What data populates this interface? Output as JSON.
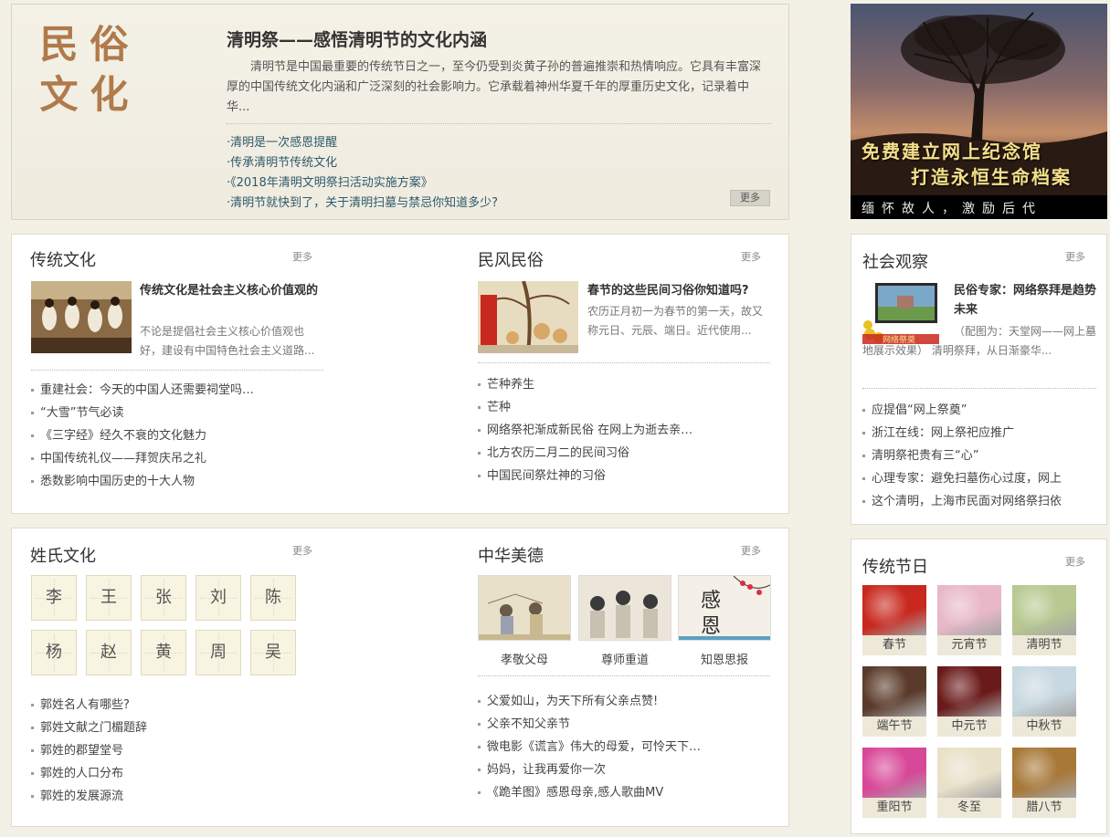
{
  "feature": {
    "logo_chars": [
      "民",
      "俗",
      "文",
      "化"
    ],
    "title": "清明祭——感悟清明节的文化内涵",
    "description": "清明节是中国最重要的传统节日之一，至今仍受到炎黄子孙的普遍推崇和热情响应。它具有丰富深厚的中国传统文化内涵和广泛深刻的社会影响力。它承载着神州华夏千年的厚重历史文化，记录着中华...",
    "links": [
      "·清明是一次感恩提醒",
      "·传承清明节传统文化",
      "·《2018年清明文明祭扫活动实施方案》",
      "·清明节就快到了，关于清明扫墓与禁忌你知道多少?"
    ],
    "more_label": "更多"
  },
  "banner": {
    "line1": "免费建立网上纪念馆",
    "line2": "打造永恒生命档案",
    "line3": "缅怀故人，激励后代"
  },
  "traditional_culture": {
    "title": "传统文化",
    "more": "更多",
    "article_title": "传统文化是社会主义核心价值观的",
    "article_desc": "不论是提倡社会主义核心价值观也好，建设有中国特色社会主义道路...",
    "items": [
      "重建社会：今天的中国人还需要祠堂吗…",
      "“大雪”节气必读",
      "《三字经》经久不衰的文化魅力",
      "中国传统礼仪——拜贺庆吊之礼",
      "悉数影响中国历史的十大人物"
    ]
  },
  "folk_customs": {
    "title": "民风民俗",
    "more": "更多",
    "article_title": "春节的这些民间习俗你知道吗?",
    "article_desc": "农历正月初一为春节的第一天，故又称元日、元辰、端日。近代使用...",
    "items": [
      "芒种养生",
      "芒种",
      "网络祭祀渐成新民俗 在网上为逝去亲…",
      "北方农历二月二的民间习俗",
      "中国民间祭灶神的习俗"
    ]
  },
  "social": {
    "title": "社会观察",
    "more": "更多",
    "article_title": "民俗专家：网络祭拜是趋势 未来",
    "article_desc": "（配图为：天堂网——网上墓地展示效果） 清明祭拜，从日渐豪华...",
    "thumb_caption": "网络祭奠",
    "items": [
      "应提倡“网上祭奠”",
      "浙江在线：网上祭祀应推广",
      "清明祭祀贵有三“心”",
      "心理专家：避免扫墓伤心过度，网上",
      "这个清明，上海市民面对网络祭扫依"
    ]
  },
  "surname_culture": {
    "title": "姓氏文化",
    "more": "更多",
    "surnames": [
      "李",
      "王",
      "张",
      "刘",
      "陈",
      "杨",
      "赵",
      "黄",
      "周",
      "吴"
    ],
    "items": [
      "郭姓名人有哪些?",
      "郭姓文献之门楣题辞",
      "郭姓的郡望堂号",
      "郭姓的人口分布",
      "郭姓的发展源流"
    ]
  },
  "virtues": {
    "title": "中华美德",
    "more": "更多",
    "cards": [
      {
        "label": "孝敬父母"
      },
      {
        "label": "尊师重道"
      },
      {
        "label": "知恩思报",
        "pic_text": "感恩"
      }
    ],
    "items": [
      "父爱如山，为天下所有父亲点赞!",
      "父亲不知父亲节",
      "微电影《谎言》伟大的母爱，可怜天下…",
      "妈妈，让我再爱你一次",
      "《跪羊图》感恩母亲,感人歌曲MV"
    ]
  },
  "festivals": {
    "title": "传统节日",
    "more": "更多",
    "list": [
      {
        "label": "春节",
        "color": "#c8281e"
      },
      {
        "label": "元宵节",
        "color": "#e8b8c8"
      },
      {
        "label": "清明节",
        "color": "#b8c890"
      },
      {
        "label": "端午节",
        "color": "#5a3a2a"
      },
      {
        "label": "中元节",
        "color": "#6a1a1a"
      },
      {
        "label": "中秋节",
        "color": "#c8d8e0"
      },
      {
        "label": "重阳节",
        "color": "#d84898"
      },
      {
        "label": "冬至",
        "color": "#e8e0c8"
      },
      {
        "label": "腊八节",
        "color": "#a87838"
      }
    ]
  }
}
